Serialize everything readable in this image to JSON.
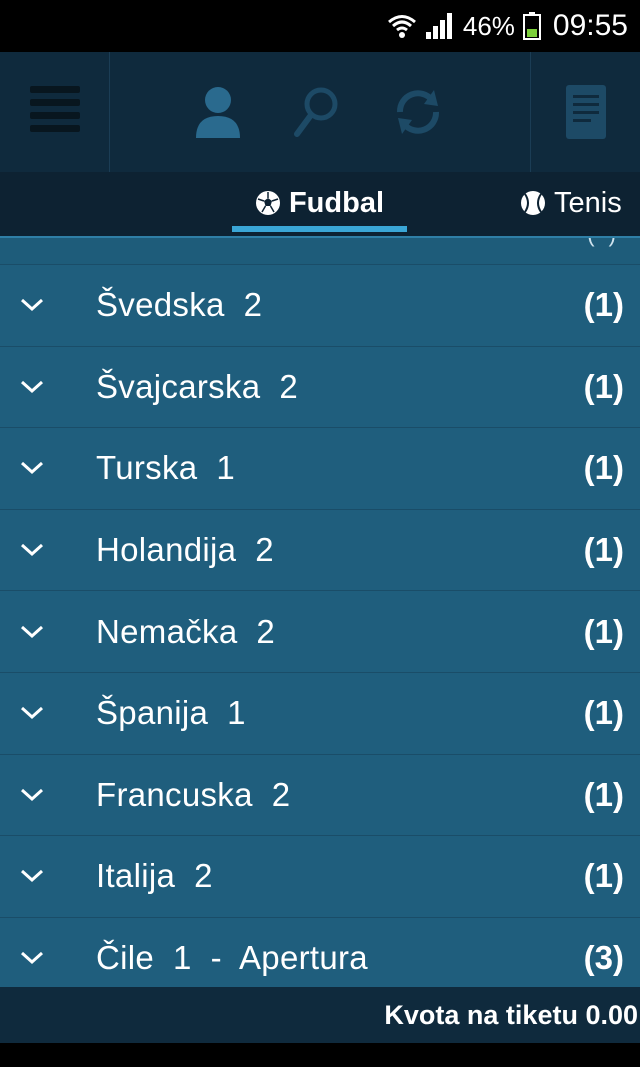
{
  "status_bar": {
    "battery_percent": "46%",
    "time": "09:55"
  },
  "toolbar": {
    "icons": [
      "menu-icon",
      "user-icon",
      "search-icon",
      "refresh-icon",
      "ticket-icon"
    ]
  },
  "tabs": [
    {
      "label": "Fudbal",
      "icon": "soccer-ball-icon",
      "active": true
    },
    {
      "label": "Tenis",
      "icon": "tennis-ball-icon",
      "active": false
    }
  ],
  "list": {
    "items": [
      {
        "name": "Švedska  2",
        "count": "(1)"
      },
      {
        "name": "Švajcarska  2",
        "count": "(1)"
      },
      {
        "name": "Turska  1",
        "count": "(1)"
      },
      {
        "name": "Holandija  2",
        "count": "(1)"
      },
      {
        "name": "Nemačka  2",
        "count": "(1)"
      },
      {
        "name": "Španija  1",
        "count": "(1)"
      },
      {
        "name": "Francuska  2",
        "count": "(1)"
      },
      {
        "name": "Italija  2",
        "count": "(1)"
      },
      {
        "name": "Čile  1  -  Apertura",
        "count": "(3)"
      }
    ]
  },
  "footer": {
    "text": "Kvota na tiketu 0.00"
  },
  "colors": {
    "toolbar_bg": "#0f2a3d",
    "list_bg": "#1f5e7d",
    "tab_accent": "#3aa6d6",
    "icon_dim": "#1d4a66"
  }
}
